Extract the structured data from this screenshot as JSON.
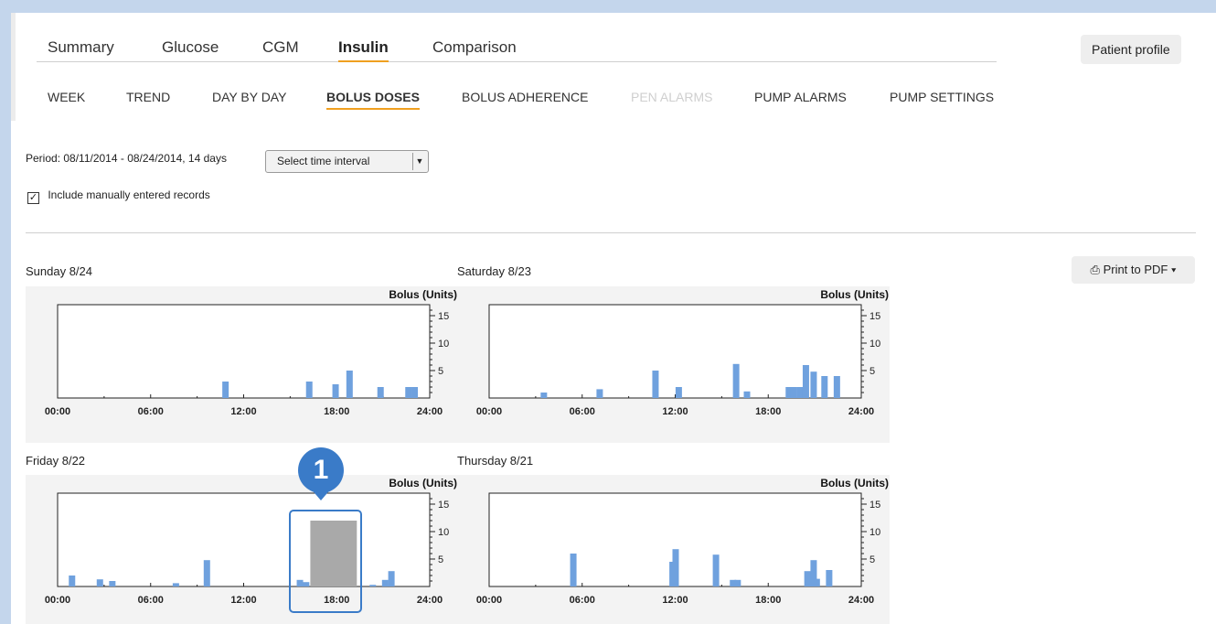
{
  "main_tabs": [
    {
      "label": "Summary",
      "active": false
    },
    {
      "label": "Glucose",
      "active": false
    },
    {
      "label": "CGM",
      "active": false
    },
    {
      "label": "Insulin",
      "active": true
    },
    {
      "label": "Comparison",
      "active": false
    }
  ],
  "sub_tabs": [
    {
      "label": "WEEK",
      "active": false,
      "disabled": false
    },
    {
      "label": "TREND",
      "active": false,
      "disabled": false
    },
    {
      "label": "DAY BY DAY",
      "active": false,
      "disabled": false
    },
    {
      "label": "BOLUS DOSES",
      "active": true,
      "disabled": false
    },
    {
      "label": "BOLUS ADHERENCE",
      "active": false,
      "disabled": false
    },
    {
      "label": "PEN ALARMS",
      "active": false,
      "disabled": true
    },
    {
      "label": "PUMP ALARMS",
      "active": false,
      "disabled": false
    },
    {
      "label": "PUMP SETTINGS",
      "active": false,
      "disabled": false
    }
  ],
  "patient_profile_label": "Patient profile",
  "period_text": "Period: 08/11/2014 - 08/24/2014, 14 days",
  "time_interval": {
    "selected": "Select time interval"
  },
  "include_manual": {
    "label": "Include manually entered records",
    "checked": true
  },
  "print_label": "Print to PDF",
  "callout_number": "1",
  "colors": {
    "bar": "#6fa1de",
    "highlight": "#3a7bc8",
    "accent": "#f0a020",
    "selection_fill": "#a9a9a9"
  },
  "chart_data": [
    {
      "type": "bar",
      "title": "Sunday 8/24",
      "ylabel": "Bolus (Units)",
      "x_ticks": [
        "00:00",
        "06:00",
        "12:00",
        "18:00",
        "24:00"
      ],
      "y_ticks": [
        5,
        10,
        15
      ],
      "xlim": [
        0,
        24
      ],
      "ylim": [
        0,
        17
      ],
      "points": [
        {
          "x": 10.8,
          "y": 3
        },
        {
          "x": 16.2,
          "y": 3
        },
        {
          "x": 17.9,
          "y": 2.5
        },
        {
          "x": 18.8,
          "y": 5
        },
        {
          "x": 20.8,
          "y": 2
        },
        {
          "x": 22.6,
          "y": 2
        },
        {
          "x": 23.0,
          "y": 2
        }
      ]
    },
    {
      "type": "bar",
      "title": "Saturday 8/23",
      "ylabel": "Bolus (Units)",
      "x_ticks": [
        "00:00",
        "06:00",
        "12:00",
        "18:00",
        "24:00"
      ],
      "y_ticks": [
        5,
        10,
        15
      ],
      "xlim": [
        0,
        24
      ],
      "ylim": [
        0,
        17
      ],
      "points": [
        {
          "x": 3.5,
          "y": 1
        },
        {
          "x": 7.1,
          "y": 1.6
        },
        {
          "x": 10.7,
          "y": 5
        },
        {
          "x": 12.2,
          "y": 2
        },
        {
          "x": 15.9,
          "y": 6.2
        },
        {
          "x": 16.6,
          "y": 1.2
        },
        {
          "x": 19.3,
          "y": 2
        },
        {
          "x": 19.6,
          "y": 2
        },
        {
          "x": 20.0,
          "y": 2
        },
        {
          "x": 20.4,
          "y": 6
        },
        {
          "x": 20.9,
          "y": 4.8
        },
        {
          "x": 21.6,
          "y": 4
        },
        {
          "x": 22.4,
          "y": 4
        }
      ]
    },
    {
      "type": "bar",
      "title": "Friday 8/22",
      "ylabel": "Bolus (Units)",
      "x_ticks": [
        "00:00",
        "06:00",
        "12:00",
        "18:00",
        "24:00"
      ],
      "y_ticks": [
        5,
        10,
        15
      ],
      "xlim": [
        0,
        24
      ],
      "ylim": [
        0,
        17
      ],
      "points": [
        {
          "x": 0.9,
          "y": 2
        },
        {
          "x": 2.7,
          "y": 1.3
        },
        {
          "x": 3.5,
          "y": 1
        },
        {
          "x": 7.6,
          "y": 0.6
        },
        {
          "x": 9.6,
          "y": 4.8
        },
        {
          "x": 15.6,
          "y": 1.2
        },
        {
          "x": 16.0,
          "y": 0.8
        },
        {
          "x": 20.3,
          "y": 0.3
        },
        {
          "x": 21.1,
          "y": 1.2
        },
        {
          "x": 21.5,
          "y": 2.8
        }
      ],
      "selection": {
        "x_start": 16.3,
        "x_end": 19.3,
        "y": 12
      }
    },
    {
      "type": "bar",
      "title": "Thursday 8/21",
      "ylabel": "Bolus (Units)",
      "x_ticks": [
        "00:00",
        "06:00",
        "12:00",
        "18:00",
        "24:00"
      ],
      "y_ticks": [
        5,
        10,
        15
      ],
      "xlim": [
        0,
        24
      ],
      "ylim": [
        0,
        17
      ],
      "points": [
        {
          "x": 5.4,
          "y": 6
        },
        {
          "x": 11.8,
          "y": 4.5
        },
        {
          "x": 12.0,
          "y": 6.8
        },
        {
          "x": 14.6,
          "y": 5.8
        },
        {
          "x": 15.7,
          "y": 1.2
        },
        {
          "x": 16.0,
          "y": 1.2
        },
        {
          "x": 20.5,
          "y": 2.8
        },
        {
          "x": 20.9,
          "y": 4.8
        },
        {
          "x": 21.1,
          "y": 1.4
        },
        {
          "x": 21.9,
          "y": 3
        }
      ]
    }
  ]
}
